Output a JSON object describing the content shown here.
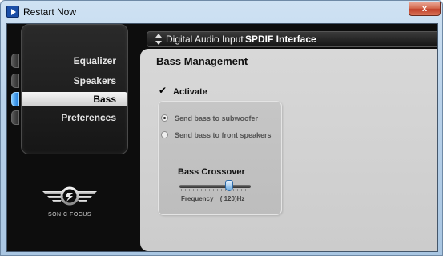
{
  "window": {
    "title": "Restart Now",
    "close_label": "x"
  },
  "nav": {
    "items": [
      {
        "label": "Equalizer",
        "active": false
      },
      {
        "label": "Speakers",
        "active": false
      },
      {
        "label": "Bass",
        "active": true
      },
      {
        "label": "Preferences",
        "active": false
      }
    ]
  },
  "logo": {
    "text": "SONIC FOCUS"
  },
  "header": {
    "device_label": "Digital Audio Input",
    "device_value": "SPDIF Interface"
  },
  "bass": {
    "title": "Bass Management",
    "activate_label": "Activate",
    "activate_checked": true,
    "options": [
      {
        "label": "Send bass to subwoofer",
        "selected": true
      },
      {
        "label": "Send bass to front speakers",
        "selected": false
      }
    ],
    "crossover_title": "Bass Crossover",
    "frequency_label": "Frequency",
    "frequency_value": "( 120)Hz",
    "slider_fraction": 0.65
  },
  "colors": {
    "accent_blue": "#1a78d8",
    "panel_dark": "#0d0d0d",
    "content_gray": "#d2d2d2"
  }
}
